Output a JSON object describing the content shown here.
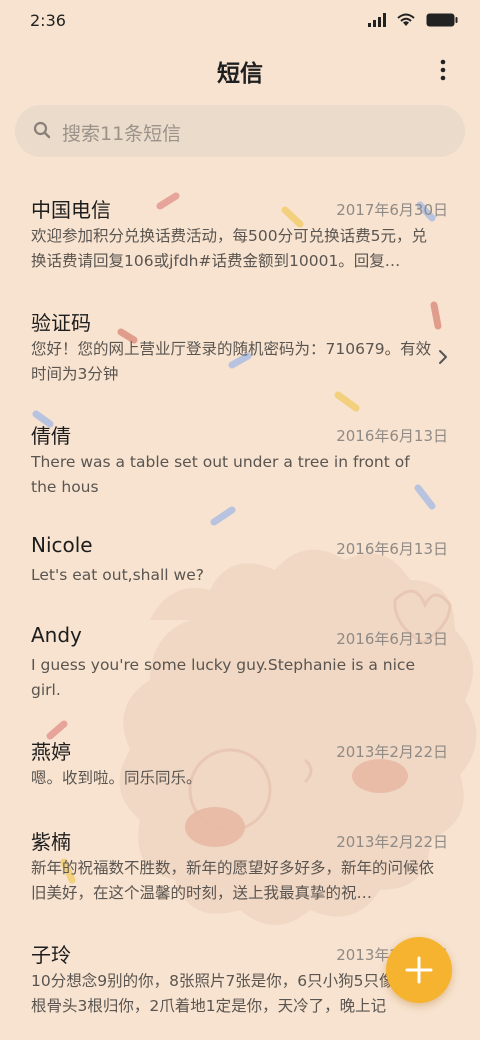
{
  "status": {
    "time": "2:36"
  },
  "header": {
    "title": "短信"
  },
  "search": {
    "placeholder": "搜索11条短信"
  },
  "messages": [
    {
      "name": "中国电信",
      "date": "2017年6月30日",
      "preview": "欢迎参加积分兑换话费活动，每500分可兑换话费5元，兑换话费请回复106或jfdh#话费金额到10001。回复…"
    },
    {
      "name": "验证码",
      "date": "",
      "preview": "您好！您的网上营业厅登录的随机密码为：710679。有效时间为3分钟"
    },
    {
      "name": "倩倩",
      "date": "2016年6月13日",
      "preview": "There was a table set out under a tree in front of the hous"
    },
    {
      "name": "Nicole",
      "date": "2016年6月13日",
      "preview": "Let's eat out,shall we?"
    },
    {
      "name": "Andy",
      "date": "2016年6月13日",
      "preview": "I guess you're some lucky guy.Stephanie is a nice girl."
    },
    {
      "name": "燕婷",
      "date": "2013年2月22日",
      "preview": "嗯。收到啦。同乐同乐。"
    },
    {
      "name": "紫楠",
      "date": "2013年2月22日",
      "preview": "新年的祝福数不胜数，新年的愿望好多好多，新年的问候依旧美好，在这个温馨的时刻，送上我最真挚的祝…"
    },
    {
      "name": "子玲",
      "date": "2013年2月22日",
      "preview": "10分想念9别的你，8张照片7张是你，6只小狗5只像你，4根骨头3根归你，2爪着地1定是你，天冷了，晚上记"
    }
  ],
  "colors": {
    "background": "#f7e3d0",
    "search_bg": "#eadbcb",
    "fab": "#f5b32f"
  },
  "icons": [
    "signal-icon",
    "wifi-icon",
    "battery-icon",
    "more-vertical-icon",
    "search-icon",
    "chevron-right-icon",
    "plus-icon"
  ]
}
